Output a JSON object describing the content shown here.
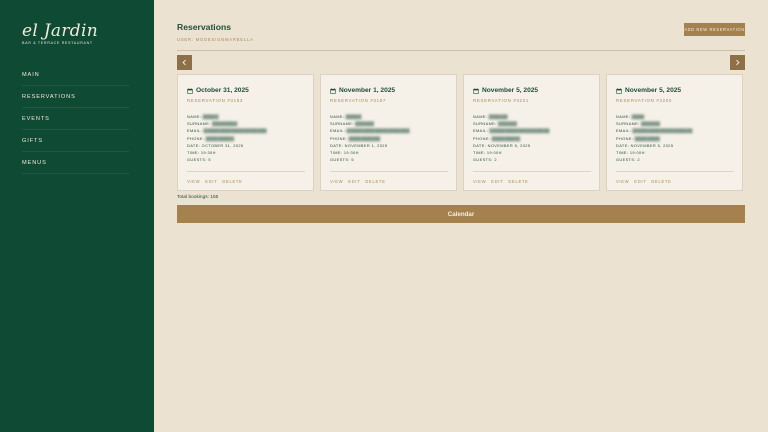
{
  "brand": {
    "name": "el Jardin",
    "tagline": "Bar & Terrace Restaurant"
  },
  "sidebar": {
    "items": [
      {
        "label": "MAIN"
      },
      {
        "label": "RESERVATIONS"
      },
      {
        "label": "EVENTS"
      },
      {
        "label": "GIFTS"
      },
      {
        "label": "MENUS"
      }
    ]
  },
  "header": {
    "title": "Reservations",
    "user": "USER: MODESIGNMARBELLA",
    "add_button": "ADD NEW RESERVATION"
  },
  "carousel": {
    "prev_icon": "chevron-left-icon",
    "next_icon": "chevron-right-icon"
  },
  "labels": {
    "name": "NAME:",
    "surname": "SURNAME:",
    "email": "EMAIL:",
    "phone": "PHONE:",
    "date": "DATE:",
    "time": "TIME:",
    "guests": "GUESTS:"
  },
  "actions": {
    "view": "VIEW",
    "edit": "EDIT",
    "delete": "DELETE"
  },
  "cards": [
    {
      "date_heading": "October 31, 2025",
      "reservation_no": "RESERVATION #3183",
      "name": "█████",
      "surname": "████████",
      "email": "████████████████████",
      "phone": "█████████",
      "date": "OCTOBER 31, 2025",
      "time": "19:30H",
      "guests": "5"
    },
    {
      "date_heading": "November 1, 2025",
      "reservation_no": "RESERVATION #3187",
      "name": "█████",
      "surname": "██████",
      "email": "████████████████████",
      "phone": "██████████",
      "date": "NOVEMBER 1, 2025",
      "time": "19:30H",
      "guests": "5"
    },
    {
      "date_heading": "November 5, 2025",
      "reservation_no": "RESERVATION #3201",
      "name": "██████",
      "surname": "██████",
      "email": "███████████████████",
      "phone": "█████████",
      "date": "NOVEMBER 5, 2025",
      "time": "19:00H",
      "guests": "2"
    },
    {
      "date_heading": "November 5, 2025",
      "reservation_no": "RESERVATION #3200",
      "name": "████",
      "surname": "██████",
      "email": "███████████████████",
      "phone": "████████",
      "date": "NOVEMBER 5, 2025",
      "time": "19:00H",
      "guests": "2"
    }
  ],
  "footer": {
    "total": "Total bookings: 155",
    "calendar_button": "Calendar"
  },
  "colors": {
    "sidebar": "#0f4a34",
    "background": "#ece2d1",
    "accent": "#a5814e",
    "heading": "#1c4f39"
  }
}
